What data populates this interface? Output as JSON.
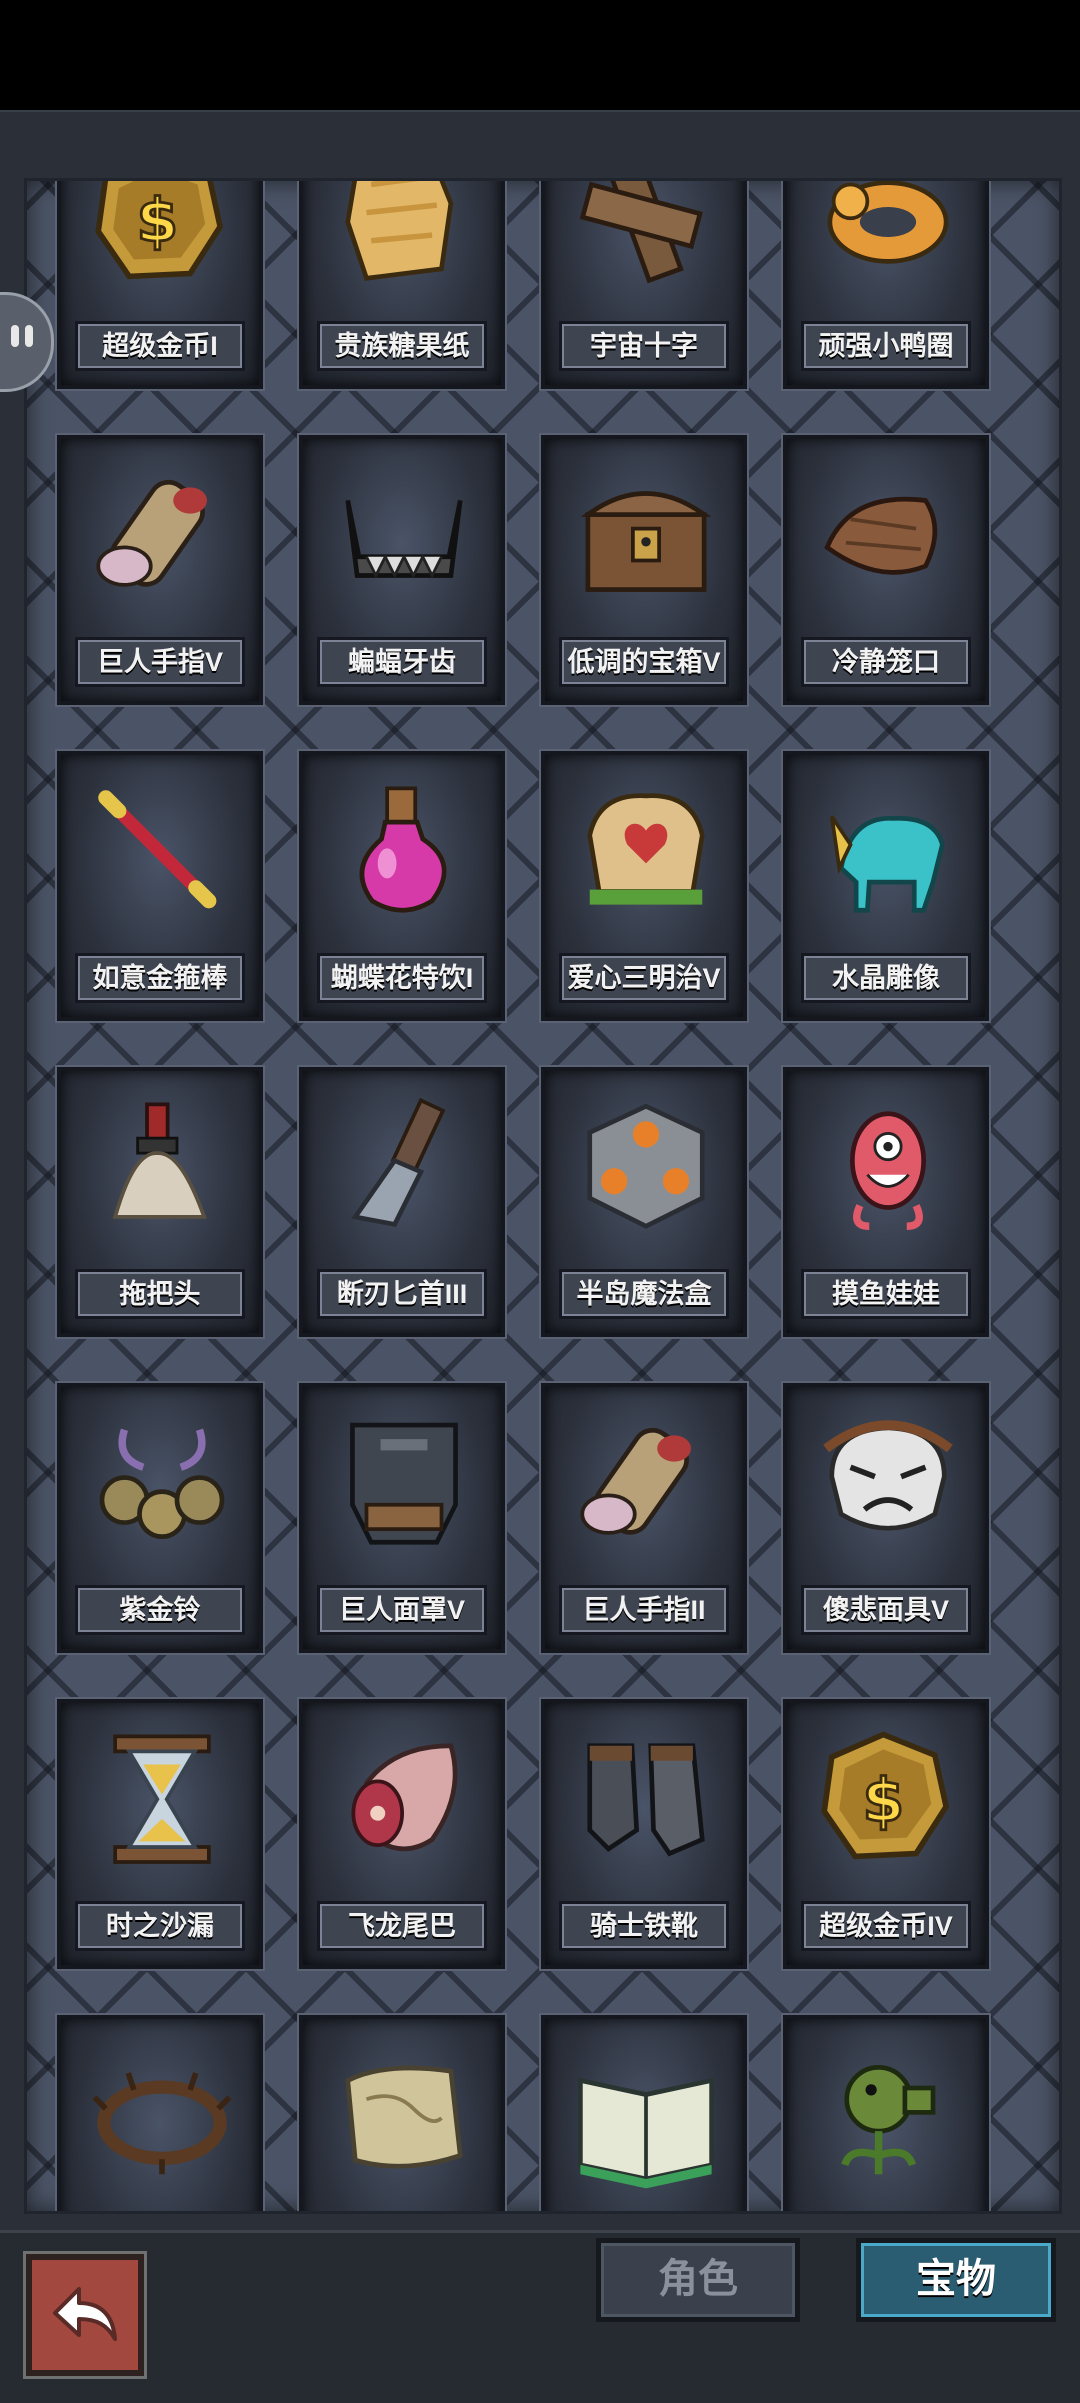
{
  "tabs": {
    "role": "角色",
    "treasure": "宝物"
  },
  "items": [
    {
      "label": "超级金币I",
      "icon": "gold-coin-icon"
    },
    {
      "label": "贵族糖果纸",
      "icon": "candy-wrapper-icon"
    },
    {
      "label": "宇宙十字",
      "icon": "wooden-cross-icon"
    },
    {
      "label": "顽强小鸭圈",
      "icon": "duck-ring-icon"
    },
    {
      "label": "巨人手指V",
      "icon": "giant-finger-icon"
    },
    {
      "label": "蝙蝠牙齿",
      "icon": "bat-teeth-icon"
    },
    {
      "label": "低调的宝箱V",
      "icon": "treasure-chest-icon"
    },
    {
      "label": "冷静笼口",
      "icon": "muzzle-icon"
    },
    {
      "label": "如意金箍棒",
      "icon": "golden-staff-icon"
    },
    {
      "label": "蝴蝶花特饮I",
      "icon": "potion-icon"
    },
    {
      "label": "爱心三明治V",
      "icon": "sandwich-icon"
    },
    {
      "label": "水晶雕像",
      "icon": "crystal-statue-icon"
    },
    {
      "label": "拖把头",
      "icon": "mop-head-icon"
    },
    {
      "label": "断刃匕首III",
      "icon": "broken-dagger-icon"
    },
    {
      "label": "半岛魔法盒",
      "icon": "magic-box-icon"
    },
    {
      "label": "摸鱼娃娃",
      "icon": "pink-doll-icon"
    },
    {
      "label": "紫金铃",
      "icon": "bells-icon"
    },
    {
      "label": "巨人面罩V",
      "icon": "giant-mask-icon"
    },
    {
      "label": "巨人手指II",
      "icon": "giant-finger-icon"
    },
    {
      "label": "傻悲面具V",
      "icon": "sad-mask-icon"
    },
    {
      "label": "时之沙漏",
      "icon": "hourglass-icon"
    },
    {
      "label": "飞龙尾巴",
      "icon": "dragon-tail-icon"
    },
    {
      "label": "骑士铁靴",
      "icon": "iron-boots-icon"
    },
    {
      "label": "超级金币IV",
      "icon": "gold-coin-icon"
    },
    {
      "label": "",
      "icon": "thorn-crown-icon"
    },
    {
      "label": "",
      "icon": "scroll-map-icon"
    },
    {
      "label": "",
      "icon": "open-book-icon"
    },
    {
      "label": "",
      "icon": "peashooter-icon"
    }
  ]
}
